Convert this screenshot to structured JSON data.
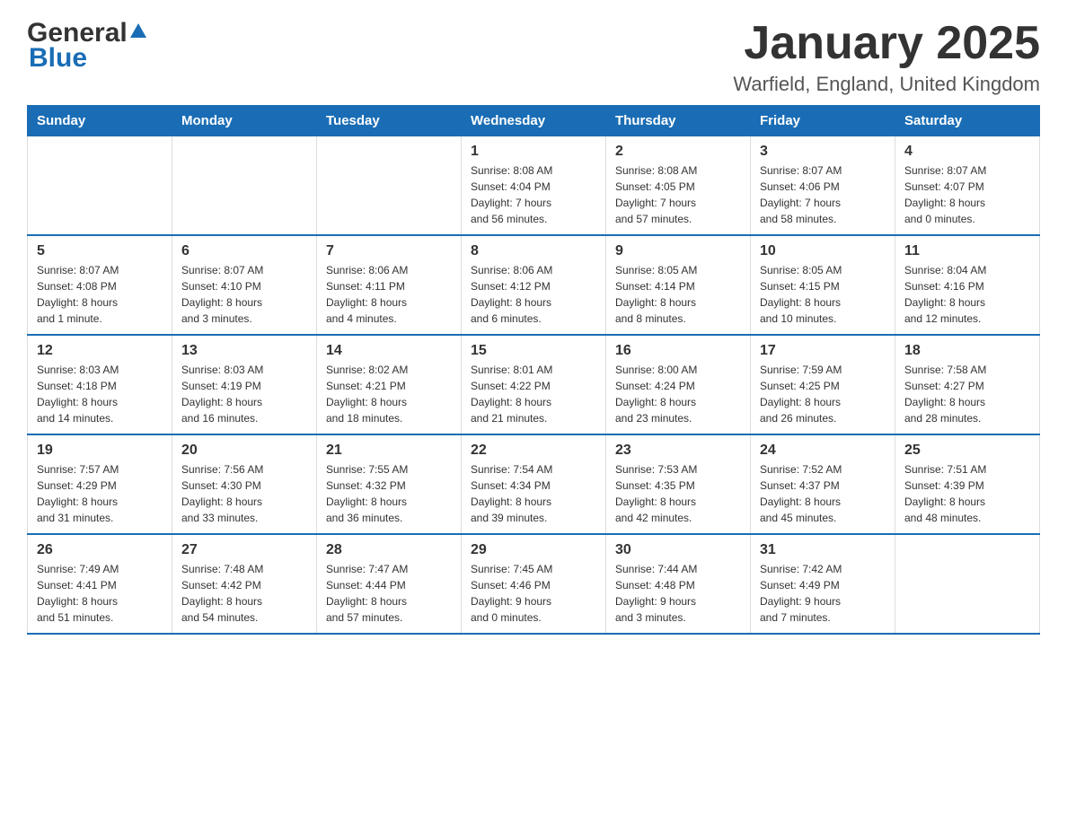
{
  "logo": {
    "text_general": "General",
    "text_blue": "Blue"
  },
  "title": "January 2025",
  "location": "Warfield, England, United Kingdom",
  "weekdays": [
    "Sunday",
    "Monday",
    "Tuesday",
    "Wednesday",
    "Thursday",
    "Friday",
    "Saturday"
  ],
  "weeks": [
    [
      {
        "day": "",
        "info": ""
      },
      {
        "day": "",
        "info": ""
      },
      {
        "day": "",
        "info": ""
      },
      {
        "day": "1",
        "info": "Sunrise: 8:08 AM\nSunset: 4:04 PM\nDaylight: 7 hours\nand 56 minutes."
      },
      {
        "day": "2",
        "info": "Sunrise: 8:08 AM\nSunset: 4:05 PM\nDaylight: 7 hours\nand 57 minutes."
      },
      {
        "day": "3",
        "info": "Sunrise: 8:07 AM\nSunset: 4:06 PM\nDaylight: 7 hours\nand 58 minutes."
      },
      {
        "day": "4",
        "info": "Sunrise: 8:07 AM\nSunset: 4:07 PM\nDaylight: 8 hours\nand 0 minutes."
      }
    ],
    [
      {
        "day": "5",
        "info": "Sunrise: 8:07 AM\nSunset: 4:08 PM\nDaylight: 8 hours\nand 1 minute."
      },
      {
        "day": "6",
        "info": "Sunrise: 8:07 AM\nSunset: 4:10 PM\nDaylight: 8 hours\nand 3 minutes."
      },
      {
        "day": "7",
        "info": "Sunrise: 8:06 AM\nSunset: 4:11 PM\nDaylight: 8 hours\nand 4 minutes."
      },
      {
        "day": "8",
        "info": "Sunrise: 8:06 AM\nSunset: 4:12 PM\nDaylight: 8 hours\nand 6 minutes."
      },
      {
        "day": "9",
        "info": "Sunrise: 8:05 AM\nSunset: 4:14 PM\nDaylight: 8 hours\nand 8 minutes."
      },
      {
        "day": "10",
        "info": "Sunrise: 8:05 AM\nSunset: 4:15 PM\nDaylight: 8 hours\nand 10 minutes."
      },
      {
        "day": "11",
        "info": "Sunrise: 8:04 AM\nSunset: 4:16 PM\nDaylight: 8 hours\nand 12 minutes."
      }
    ],
    [
      {
        "day": "12",
        "info": "Sunrise: 8:03 AM\nSunset: 4:18 PM\nDaylight: 8 hours\nand 14 minutes."
      },
      {
        "day": "13",
        "info": "Sunrise: 8:03 AM\nSunset: 4:19 PM\nDaylight: 8 hours\nand 16 minutes."
      },
      {
        "day": "14",
        "info": "Sunrise: 8:02 AM\nSunset: 4:21 PM\nDaylight: 8 hours\nand 18 minutes."
      },
      {
        "day": "15",
        "info": "Sunrise: 8:01 AM\nSunset: 4:22 PM\nDaylight: 8 hours\nand 21 minutes."
      },
      {
        "day": "16",
        "info": "Sunrise: 8:00 AM\nSunset: 4:24 PM\nDaylight: 8 hours\nand 23 minutes."
      },
      {
        "day": "17",
        "info": "Sunrise: 7:59 AM\nSunset: 4:25 PM\nDaylight: 8 hours\nand 26 minutes."
      },
      {
        "day": "18",
        "info": "Sunrise: 7:58 AM\nSunset: 4:27 PM\nDaylight: 8 hours\nand 28 minutes."
      }
    ],
    [
      {
        "day": "19",
        "info": "Sunrise: 7:57 AM\nSunset: 4:29 PM\nDaylight: 8 hours\nand 31 minutes."
      },
      {
        "day": "20",
        "info": "Sunrise: 7:56 AM\nSunset: 4:30 PM\nDaylight: 8 hours\nand 33 minutes."
      },
      {
        "day": "21",
        "info": "Sunrise: 7:55 AM\nSunset: 4:32 PM\nDaylight: 8 hours\nand 36 minutes."
      },
      {
        "day": "22",
        "info": "Sunrise: 7:54 AM\nSunset: 4:34 PM\nDaylight: 8 hours\nand 39 minutes."
      },
      {
        "day": "23",
        "info": "Sunrise: 7:53 AM\nSunset: 4:35 PM\nDaylight: 8 hours\nand 42 minutes."
      },
      {
        "day": "24",
        "info": "Sunrise: 7:52 AM\nSunset: 4:37 PM\nDaylight: 8 hours\nand 45 minutes."
      },
      {
        "day": "25",
        "info": "Sunrise: 7:51 AM\nSunset: 4:39 PM\nDaylight: 8 hours\nand 48 minutes."
      }
    ],
    [
      {
        "day": "26",
        "info": "Sunrise: 7:49 AM\nSunset: 4:41 PM\nDaylight: 8 hours\nand 51 minutes."
      },
      {
        "day": "27",
        "info": "Sunrise: 7:48 AM\nSunset: 4:42 PM\nDaylight: 8 hours\nand 54 minutes."
      },
      {
        "day": "28",
        "info": "Sunrise: 7:47 AM\nSunset: 4:44 PM\nDaylight: 8 hours\nand 57 minutes."
      },
      {
        "day": "29",
        "info": "Sunrise: 7:45 AM\nSunset: 4:46 PM\nDaylight: 9 hours\nand 0 minutes."
      },
      {
        "day": "30",
        "info": "Sunrise: 7:44 AM\nSunset: 4:48 PM\nDaylight: 9 hours\nand 3 minutes."
      },
      {
        "day": "31",
        "info": "Sunrise: 7:42 AM\nSunset: 4:49 PM\nDaylight: 9 hours\nand 7 minutes."
      },
      {
        "day": "",
        "info": ""
      }
    ]
  ]
}
